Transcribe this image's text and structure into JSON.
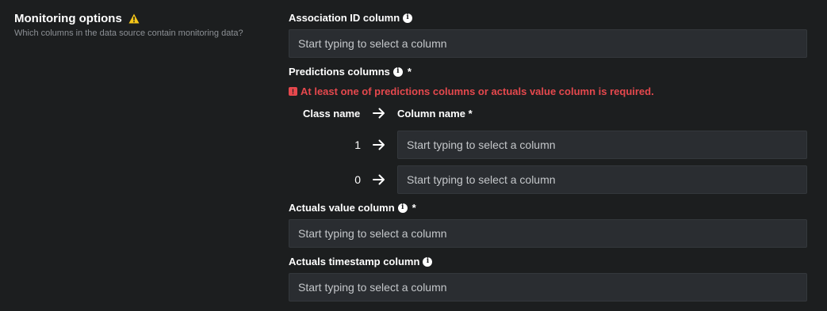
{
  "section": {
    "title": "Monitoring options",
    "description": "Which columns in the data source contain monitoring data?",
    "warning_icon": "warning-triangle-icon",
    "warning_color": "#f5c518"
  },
  "association_id": {
    "label": "Association ID column",
    "placeholder": "Start typing to select a column"
  },
  "predictions": {
    "label": "Predictions columns",
    "required_mark": "*",
    "error": "At least one of predictions columns or actuals value column is required.",
    "class_header": "Class name",
    "column_header": "Column name *",
    "rows": [
      {
        "class_name": "1",
        "placeholder": "Start typing to select a column"
      },
      {
        "class_name": "0",
        "placeholder": "Start typing to select a column"
      }
    ]
  },
  "actuals_value": {
    "label": "Actuals value column",
    "required_mark": "*",
    "placeholder": "Start typing to select a column"
  },
  "actuals_timestamp": {
    "label": "Actuals timestamp column",
    "placeholder": "Start typing to select a column"
  },
  "colors": {
    "background": "#1c1e1f",
    "input_bg": "#2a2d31",
    "error": "#e5484d"
  }
}
